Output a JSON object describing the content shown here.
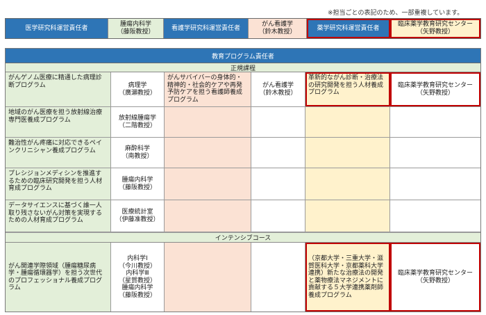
{
  "note": "※担当ごとの表記のため、一部重複しています。",
  "header": {
    "cells": [
      "医学研究科運営責任者",
      "腫瘍内科学\n（藤阪教授）",
      "看護学研究科運営責任者",
      "がん看護学\n（鈴木教授）",
      "薬学研究科運営責任者",
      "臨床薬学教育研究センター\n（矢野教授）"
    ]
  },
  "table": {
    "title": "教育プログラム責任者",
    "section_regular": "正規課程",
    "section_intensive": "インテンシブコース",
    "regular_rows": [
      {
        "program": "がんゲノム医療に精通した病理診断プログラム",
        "dept": "病理学\n（廣瀬教授）",
        "nursing": "がんサバイバーの身体的・精神的・社会的ケアや再発予防ケアを担う看護師養成プログラム",
        "nurse_dept": "がん看護学\n（鈴木教授）",
        "pharm": "革新的ながん診断・治療法の研究開発を担う人材養成プログラム",
        "pharm_dept": "臨床薬学教育研究センター\n（矢野教授）"
      },
      {
        "program": "地域のがん医療を担う放射線治療専門医養成プログラム",
        "dept": "放射線腫瘍学\n（二階教授）"
      },
      {
        "program": "難治性がん疼痛に対応できるペインクリニシャン養成プログラム",
        "dept": "麻酔科学\n（南教授）"
      },
      {
        "program": "プレシジョンメディシンを推進するための臨床研究開発を担う人材育成プログラム",
        "dept": "腫瘍内科学\n（藤阪教授）"
      },
      {
        "program": "データサイエンスに基づく誰一人取り残さないがん対策を実現するための人材育成プログラム",
        "dept": "医療統計室\n（伊藤准教授）"
      }
    ],
    "intensive": {
      "program": "がん関連学際領域（腫瘍糖尿病学・腫瘍循環器学）を担う次世代のプロフェッショナル養成プログラム",
      "dept": "内科学Ⅰ\n（今川教授）\n内科学Ⅲ\n（星賀教授）\n腫瘍内科学\n（藤阪教授）",
      "pharm": "（京都大学・三重大学・滋賀医科大学・京都薬科大学連携）新たな治療法の開発と薬物療法マネジメントに貢献する５大学連携薬剤師養成プログラム",
      "pharm_dept": "臨床薬学教育研究センター\n（矢野教授）"
    }
  }
}
